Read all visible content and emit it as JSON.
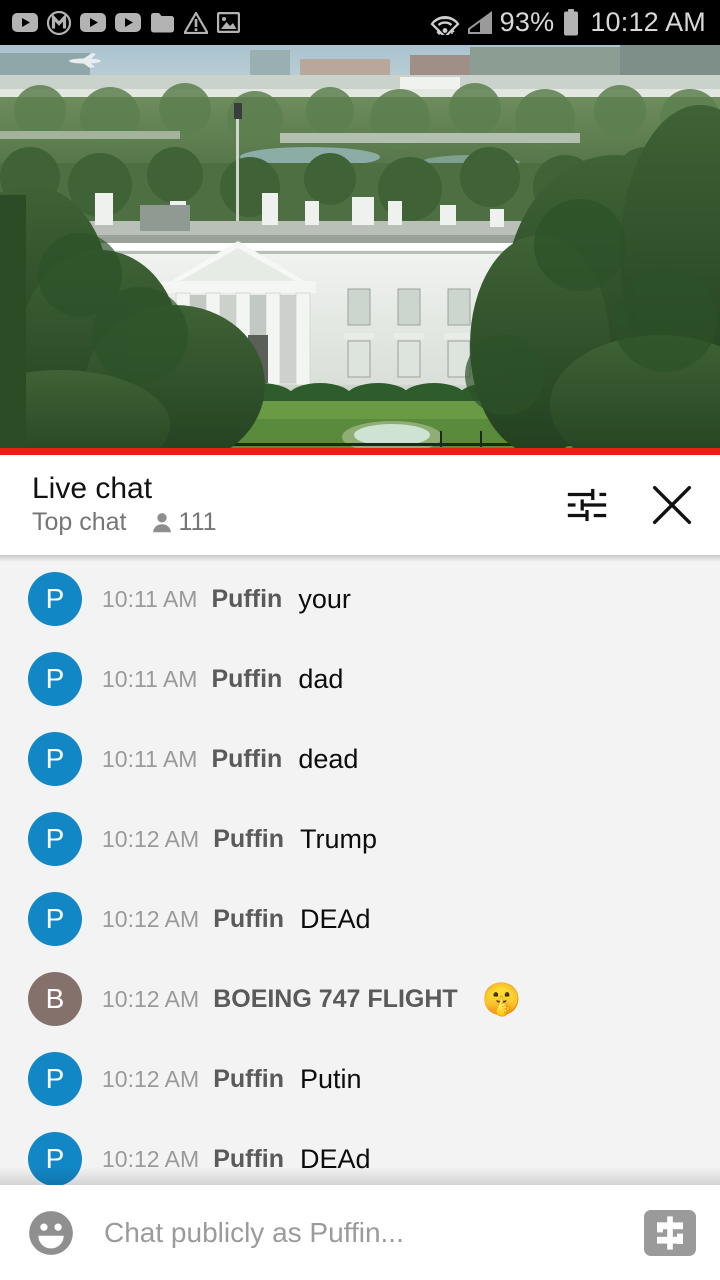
{
  "status_bar": {
    "notification_icons": [
      "youtube-icon",
      "m-badge-icon",
      "youtube-icon",
      "youtube-icon",
      "folder-icon",
      "warning-triangle-icon",
      "image-icon"
    ],
    "wifi_icon": "wifi-icon",
    "signal_icon": "cell-signal-icon",
    "battery_percent": "93%",
    "battery_icon": "battery-icon",
    "clock": "10:12 AM"
  },
  "video": {
    "scene": "White House south lawn live stream",
    "progress_percent": 100,
    "progress_color": "#e62117"
  },
  "chat_header": {
    "title": "Live chat",
    "mode_label": "Top chat",
    "viewer_icon": "person-icon",
    "viewer_count": "111",
    "settings_icon": "tune-sliders-icon",
    "close_icon": "close-icon"
  },
  "messages": [
    {
      "avatar_letter": "P",
      "avatar_color": "#1287c6",
      "time": "10:11 AM",
      "author": "Puffin",
      "text": "your",
      "emoji": ""
    },
    {
      "avatar_letter": "P",
      "avatar_color": "#1287c6",
      "time": "10:11 AM",
      "author": "Puffin",
      "text": "dad",
      "emoji": ""
    },
    {
      "avatar_letter": "P",
      "avatar_color": "#1287c6",
      "time": "10:11 AM",
      "author": "Puffin",
      "text": "dead",
      "emoji": ""
    },
    {
      "avatar_letter": "P",
      "avatar_color": "#1287c6",
      "time": "10:12 AM",
      "author": "Puffin",
      "text": "Trump",
      "emoji": ""
    },
    {
      "avatar_letter": "P",
      "avatar_color": "#1287c6",
      "time": "10:12 AM",
      "author": "Puffin",
      "text": "DEAd",
      "emoji": ""
    },
    {
      "avatar_letter": "B",
      "avatar_color": "#85716b",
      "time": "10:12 AM",
      "author": "BOEING 747 FLIGHT",
      "text": "",
      "emoji": "🤫"
    },
    {
      "avatar_letter": "P",
      "avatar_color": "#1287c6",
      "time": "10:12 AM",
      "author": "Puffin",
      "text": "Putin",
      "emoji": ""
    },
    {
      "avatar_letter": "P",
      "avatar_color": "#1287c6",
      "time": "10:12 AM",
      "author": "Puffin",
      "text": "DEAd",
      "emoji": ""
    }
  ],
  "composer": {
    "emoji_icon": "emoji-smiley-icon",
    "placeholder": "Chat publicly as Puffin...",
    "value": "",
    "super_chat_icon": "money-dollar-icon"
  }
}
